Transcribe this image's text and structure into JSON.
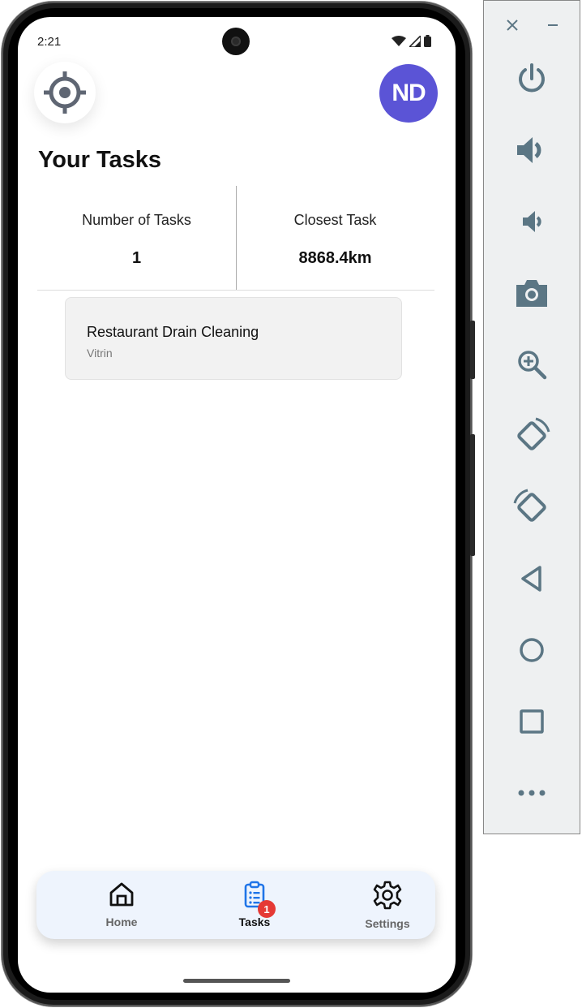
{
  "status_bar": {
    "time": "2:21"
  },
  "header": {
    "avatar_initials": "ND",
    "location_icon": "crosshair-icon"
  },
  "page": {
    "title": "Your Tasks"
  },
  "stats": {
    "count_label": "Number of Tasks",
    "count_value": "1",
    "closest_label": "Closest Task",
    "closest_value": "8868.4km"
  },
  "tasks": [
    {
      "title": "Restaurant Drain Cleaning",
      "subtitle": "Vitrin"
    }
  ],
  "bottom_nav": {
    "items": [
      {
        "label": "Home",
        "icon": "home-icon",
        "active": false
      },
      {
        "label": "Tasks",
        "icon": "clipboard-list-icon",
        "active": true,
        "badge": "1"
      },
      {
        "label": "Settings",
        "icon": "gear-icon",
        "active": false
      }
    ]
  },
  "emulator_toolbar": {
    "buttons": [
      "close-icon",
      "minimize-icon",
      "power-icon",
      "volume-up-icon",
      "volume-down-icon",
      "camera-icon",
      "zoom-icon",
      "rotate-left-icon",
      "rotate-right-icon",
      "back-icon",
      "home-circle-icon",
      "overview-icon",
      "more-icon"
    ]
  },
  "colors": {
    "avatar": "#5b54d6",
    "nav_background": "#eef4fd",
    "active_tab": "#1f74e8",
    "badge": "#e53935",
    "emulator_icon": "#5b7684"
  }
}
